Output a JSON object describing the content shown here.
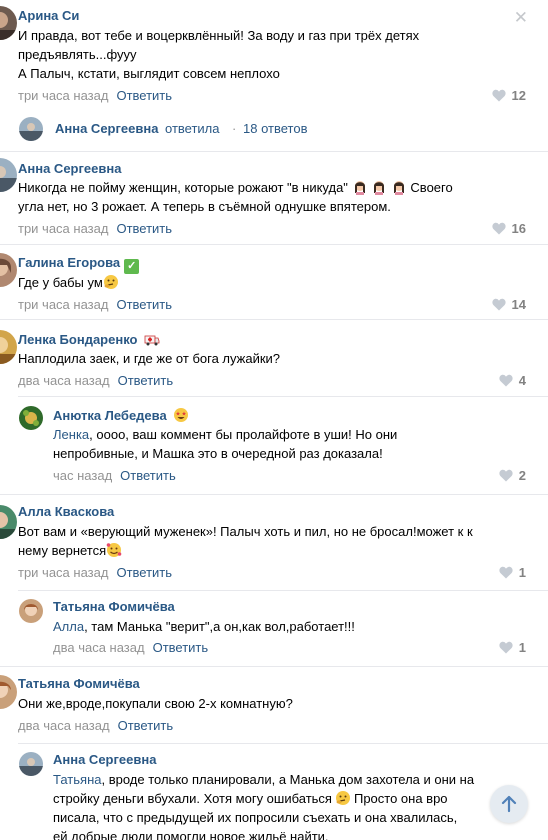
{
  "comments": [
    {
      "author": "Арина Си",
      "line1": "И правда, вот тебе и воцерквлённый! За воду и газ при трёх детях",
      "line2": "предъявлять...фууу",
      "line3": "А Палыч, кстати, выглядит совсем неплохо",
      "time": "три часа назад",
      "reply": "Ответить",
      "likes": "12"
    },
    {
      "author": "Анна Сергеевна",
      "line1a": "Никогда не пойму женщин, которые рожают \"в никуда\"",
      "line1b": "Своего",
      "line2": "угла нет, но 3 рожает. А теперь в съёмной однушке впятером.",
      "time": "три часа назад",
      "reply": "Ответить",
      "likes": "16"
    },
    {
      "author": "Галина Егорова",
      "line1": "Где у бабы ум",
      "time": "три часа назад",
      "reply": "Ответить",
      "likes": "14"
    },
    {
      "author": "Ленка Бондаренко",
      "line1": "Наплодила заек, и где же от бога лужайки?",
      "time": "два часа назад",
      "reply": "Ответить",
      "likes": "4"
    },
    {
      "author": "Анютка Лебедева",
      "mention": "Ленка",
      "line1": ", оооо, ваш коммент бы пролайфоте в уши! Но они",
      "line2": "непробивные, и Машка это в очередной раз доказала!",
      "time": "час назад",
      "reply": "Ответить",
      "likes": "2"
    },
    {
      "author": "Алла Кваскова",
      "line1": "Вот вам и «верующий муженек»! Палыч хоть и пил, но не бросал!может к к",
      "line2": "нему вернется",
      "time": "три часа назад",
      "reply": "Ответить",
      "likes": "1"
    },
    {
      "author": "Татьяна Фомичёва",
      "mention": "Алла",
      "line1": ", там Манька \"верит\",а он,как вол,работает!!!",
      "time": "два часа назад",
      "reply": "Ответить",
      "likes": "1"
    },
    {
      "author": "Татьяна Фомичёва",
      "line1": "Они же,вроде,покупали свою 2-х комнатную?",
      "time": "два часа назад",
      "reply": "Ответить"
    },
    {
      "author": "Анна Сергеевна",
      "mention": "Татьяна",
      "line1": ", вроде только планировали, а Манька дом захотела и они на",
      "line2a": "стройку деньги вбухали. Хотя могу ошибаться",
      "line2b": "Просто она вро",
      "line3": "писала, что с предыдущей их попросили съехать и она хвалилась,",
      "line4": "ей добрые люди помогли новое жильё найти."
    }
  ],
  "thread": {
    "author": "Анна Сергеевна",
    "verb": "ответила",
    "dot": "·",
    "count": "18 ответов"
  },
  "close_glyph": "✕",
  "icons": {
    "like": "heart-icon",
    "scroll": "arrow-up-icon",
    "check": "check-mark-icon"
  },
  "colors": {
    "link": "#2a5885",
    "meta": "#939393",
    "like": "#828282",
    "divider": "#e7e8ec",
    "badge": "#5fb94e"
  }
}
